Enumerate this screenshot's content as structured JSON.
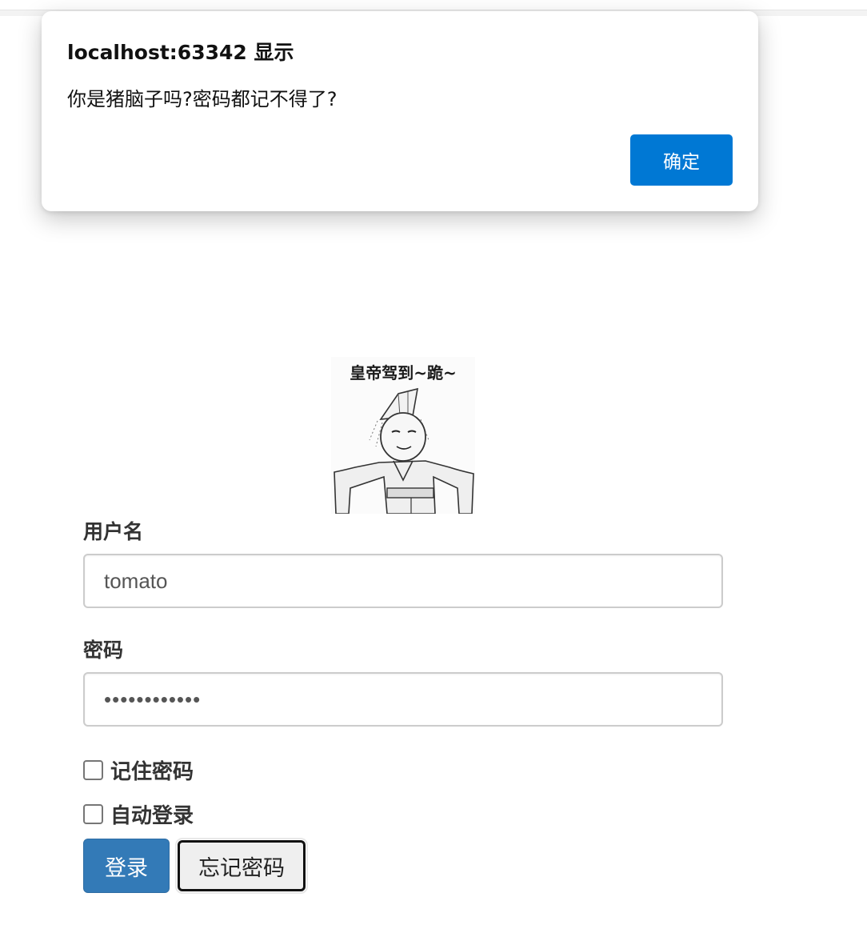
{
  "alert": {
    "title": "localhost:63342 显示",
    "message": "你是猪脑子吗?密码都记不得了?",
    "ok_label": "确定"
  },
  "picture": {
    "caption": "皇帝驾到~跪~"
  },
  "form": {
    "username_label": "用户名",
    "username_value": "tomato",
    "password_label": "密码",
    "password_value": "••••••••••••",
    "remember_label": "记住密码",
    "auto_login_label": "自动登录",
    "login_label": "登录",
    "forgot_label": "忘记密码"
  },
  "colors": {
    "alert_button": "#0078d4",
    "login_button": "#337ab7"
  }
}
